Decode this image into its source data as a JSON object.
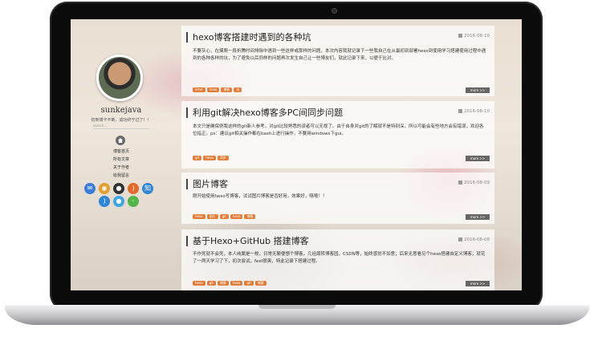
{
  "sidebar": {
    "name": "sunkejava",
    "motto": "初到博卡不断，成功终于过了！！",
    "search_placeholder": "search...",
    "nav": [
      "博客首页",
      "所有文章",
      "关于作者",
      "给我留言"
    ],
    "social_icons": [
      "mail-icon",
      "weibo-icon",
      "github-icon",
      "rss-icon",
      "zhihu-icon",
      "rss-icon",
      "qq-icon",
      "wechat-icon"
    ]
  },
  "posts": [
    {
      "title": "hexo博客搭建时遇到的各种坑",
      "date": "2016-08-10",
      "body": "不要灰心，在摸爬一段折腾时间排除中遇到一些这样或那样的问题，本次内容我就记录下一些我自己在从最初到部署hexo到使用学习搭建使用过程中遇到的各种各样的坑，为了避免以后同样的问题再次发生自己让一些博友们，就此记录下来，以便于比对。",
      "tags": [
        "error",
        "hexo",
        "博客",
        "坑"
      ],
      "more": "more >>"
    },
    {
      "title": "利用git解决hexo博客多PC间同步问题",
      "date": "2016-08-10",
      "body": "本文只是确保例我这样的git新人参考，对git比较熟悉的读者可以无视了。由于自身对git的了解就不是特别深，所以可能会有些地方会有错误，欢迎各位指正。ps：建议git相关操作都在bash上进行操作，不要用windows下gui。",
      "tags": [
        "git",
        "hexo",
        "同步"
      ],
      "more": "more >>"
    },
    {
      "title": "图片博客",
      "date": "2016-08-09",
      "body": "刚开始使用hexo写博客，试试图片博客是否好用，效果好，嘻嘻！！",
      "tags": [
        "hexo",
        "图片",
        "git",
        "hexo",
        "博客"
      ],
      "more": "more >>"
    },
    {
      "title": "基于Hexo+GitHub 搭建博客",
      "date": "2016-08-08",
      "body": "不作死就不会死，本人纯属是一枚，日常无聊便想个博客，几经周转博客园，CSDN等，始终感觉不如意；后来无意看见个hexo搭建自定义博客，就花了一两天学习了下，初次尝试，feel很爽，特此记录下搭建过程。",
      "tags": [
        "hexo",
        "git",
        "博客",
        "hexo",
        "git",
        "博客"
      ],
      "more": "more >>"
    }
  ],
  "colors": {
    "tag": "#e07d3a",
    "more": "#666666",
    "bezel": "#0b0b0c"
  }
}
